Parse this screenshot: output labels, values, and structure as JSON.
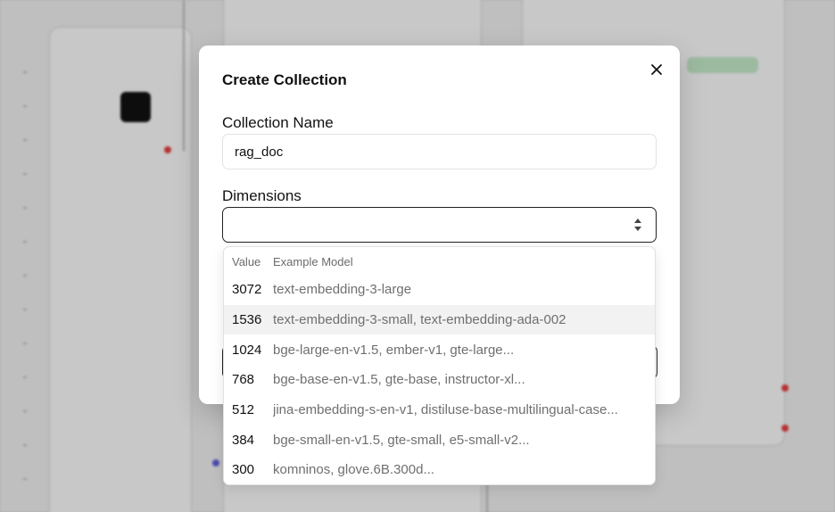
{
  "modal": {
    "title": "Create Collection",
    "collection_name_label": "Collection Name",
    "collection_name_value": "rag_doc",
    "dimensions_label": "Dimensions",
    "dimensions_value": ""
  },
  "dropdown": {
    "header_value": "Value",
    "header_model": "Example Model",
    "options": [
      {
        "value": "3072",
        "model": "text-embedding-3-large"
      },
      {
        "value": "1536",
        "model": "text-embedding-3-small, text-embedding-ada-002"
      },
      {
        "value": "1024",
        "model": "bge-large-en-v1.5, ember-v1, gte-large..."
      },
      {
        "value": "768",
        "model": "bge-base-en-v1.5, gte-base, instructor-xl..."
      },
      {
        "value": "512",
        "model": "jina-embedding-s-en-v1, distiluse-base-multilingual-case..."
      },
      {
        "value": "384",
        "model": "bge-small-en-v1.5, gte-small, e5-small-v2..."
      },
      {
        "value": "300",
        "model": "komninos, glove.6B.300d..."
      }
    ],
    "highlighted_value": "1536"
  },
  "colors": {
    "overlay": "#00000030",
    "modal_bg": "#ffffff",
    "highlight": "#f2f2f2",
    "port_red": "#e03c3c",
    "port_blue": "#5b5bd6"
  }
}
